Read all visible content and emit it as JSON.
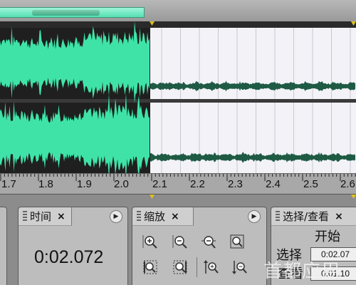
{
  "ruler": {
    "labels": [
      "1.7",
      "1.8",
      "1.9",
      "2.0",
      "2.1",
      "2.2",
      "2.3",
      "2.4",
      "2.5",
      "2.6"
    ]
  },
  "colors": {
    "waveform_selected": "#3fe3a8",
    "waveform_unselected": "#1e5a44",
    "selection_background": "#1f1f1f",
    "unselected_background": "#f2f2f7",
    "marker": "#e0c020"
  },
  "panels": {
    "time": {
      "title": "时间",
      "value": "0:02.072"
    },
    "zoom": {
      "title": "缩放",
      "buttons": [
        "zoom-in-horizontal-icon",
        "zoom-out-horizontal-icon",
        "zoom-full-icon",
        "zoom-selection-icon",
        "zoom-left-edge-icon",
        "zoom-right-edge-icon",
        "zoom-in-vertical-icon",
        "zoom-out-vertical-icon"
      ]
    },
    "selection": {
      "title": "选择/查看",
      "start_header": "开始",
      "row1_label": "选择",
      "row2_label": "查看",
      "row1_value": "0:02.07",
      "row2_value": "0:01.10"
    }
  },
  "watermark": "首都应用"
}
